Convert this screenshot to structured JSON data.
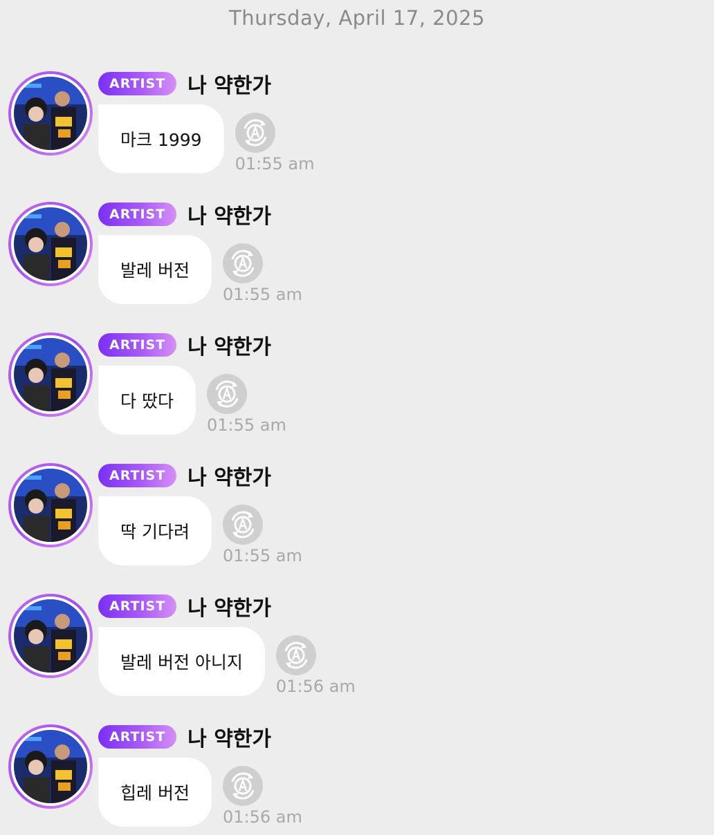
{
  "date_header": "Thursday, April 17, 2025",
  "badge_label": "ARTIST",
  "sender_name": "나 약한가",
  "colors": {
    "background": "#ededed",
    "badge_gradient_start": "#7b2ff5",
    "badge_gradient_end": "#d68ff7",
    "bubble": "#ffffff",
    "timestamp": "#a9a9a9"
  },
  "icons": {
    "translate": "translate-icon",
    "avatar": "artist-avatar"
  },
  "messages": [
    {
      "text": "마크 1999",
      "time": "01:55 am"
    },
    {
      "text": "발레 버전",
      "time": "01:55 am"
    },
    {
      "text": "다 땄다",
      "time": "01:55 am"
    },
    {
      "text": "딱 기다려",
      "time": "01:55 am"
    },
    {
      "text": "발레 버전 아니지",
      "time": "01:56 am"
    },
    {
      "text": "힙레 버전",
      "time": "01:56 am"
    }
  ]
}
